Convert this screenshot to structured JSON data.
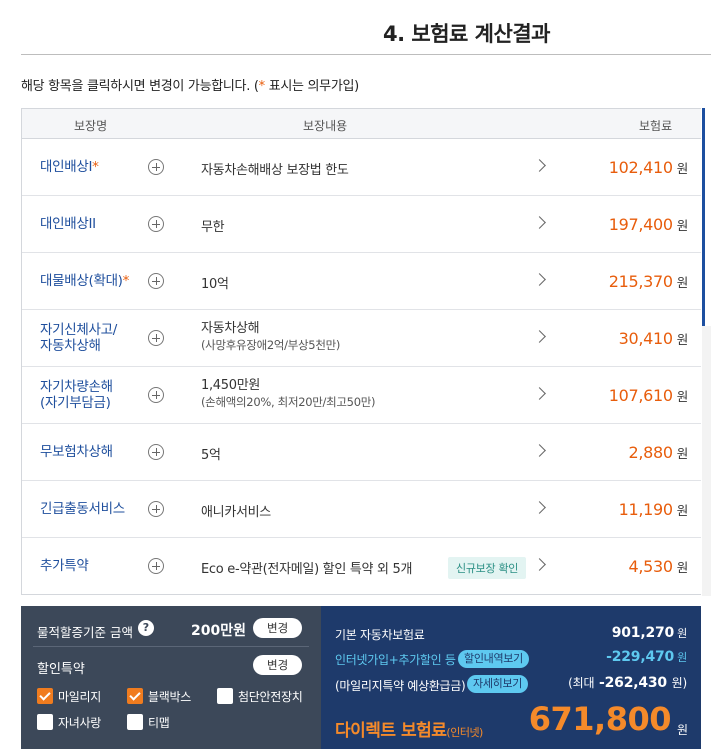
{
  "page_title": "4. 보험료 계산결과",
  "notice": {
    "prefix": "해당 항목을 클릭하시면 변경이 가능합니다. (",
    "star": "*",
    "suffix": " 표시는 의무가입)"
  },
  "table": {
    "headers": [
      "보장명",
      "보장내용",
      "보험료"
    ],
    "currency": "원",
    "rows": [
      {
        "name": "대인배상I",
        "required": "*",
        "content": "자동차손해배상 보장법 한도",
        "sub": "",
        "amount": "102,410"
      },
      {
        "name": "대인배상II",
        "required": "",
        "content": "무한",
        "sub": "",
        "amount": "197,400"
      },
      {
        "name": "대물배상(확대)",
        "required": "*",
        "content": "10억",
        "sub": "",
        "amount": "215,370"
      },
      {
        "name": "자기신체사고/",
        "name2": "자동차상해",
        "required": "",
        "content": "자동차상해",
        "sub": "(사망후유장애2억/부상5천만)",
        "amount": "30,410"
      },
      {
        "name": "자기차량손해",
        "name2": "(자기부담금)",
        "required": "",
        "content": "1,450만원",
        "sub": "(손해액의20%, 최저20만/최고50만)",
        "amount": "107,610"
      },
      {
        "name": "무보험차상해",
        "required": "",
        "content": "5억",
        "sub": "",
        "amount": "2,880"
      },
      {
        "name": "긴급출동서비스",
        "required": "",
        "content": "애니카서비스",
        "sub": "",
        "amount": "11,190"
      },
      {
        "name": "추가특약",
        "required": "",
        "content": "Eco e-약관(전자메일) 할인 특약 외 5개",
        "sub": "",
        "badge": "신규보장 확인",
        "amount": "4,530"
      }
    ]
  },
  "bottom_left": {
    "property_label": "물적할증기준 금액",
    "help_icon": "?",
    "property_value": "200만원",
    "change_label": "변경",
    "discount_label": "할인특약",
    "discount_change_label": "변경",
    "checkboxes": [
      {
        "label": "마일리지",
        "checked": true
      },
      {
        "label": "블랙박스",
        "checked": true
      },
      {
        "label": "첨단안전장치",
        "checked": false
      },
      {
        "label": "자녀사랑",
        "checked": false
      },
      {
        "label": "티맵",
        "checked": false
      }
    ]
  },
  "bottom_right": {
    "base_label": "기본 자동차보험료",
    "base_value": "901,270",
    "discount_label": "인터넷가입+추가할인 등",
    "discount_pill": "할인내역보기",
    "discount_value": "-229,470",
    "mileage_label": "(마일리지특약 예상환급금)",
    "mileage_pill": "자세히보기",
    "mileage_prefix": "(최대",
    "mileage_value": "-262,430",
    "mileage_suffix": "원)",
    "won": "원",
    "final_label": "다이렉트 보험료",
    "final_label_small": "(인터넷)",
    "final_value": "671,800",
    "final_won": "원"
  },
  "colors": {
    "accent_orange": "#e85d0c",
    "name_blue": "#1f4f9d",
    "panel_dark": "#3c4859",
    "panel_navy": "#1e3a6b",
    "cyan": "#5ec9f0"
  }
}
